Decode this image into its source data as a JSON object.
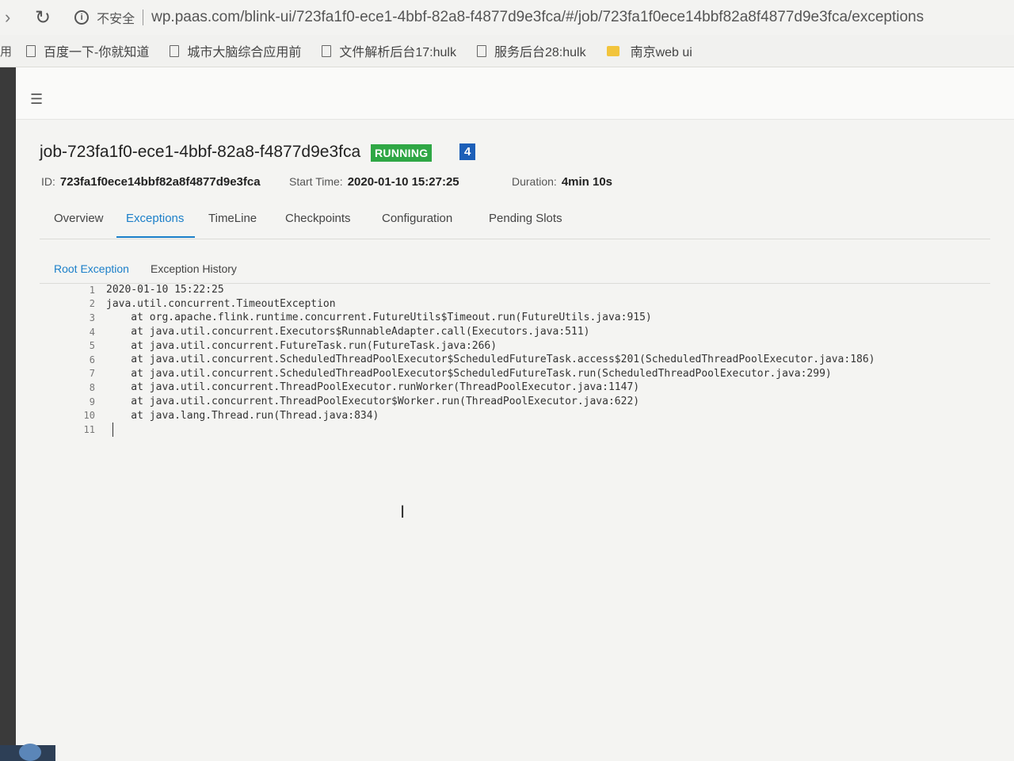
{
  "browser": {
    "security_label": "不安全",
    "url": "wp.paas.com/blink-ui/723fa1f0-ece1-4bbf-82a8-f4877d9e3fca/#/job/723fa1f0ece14bbf82a8f4877d9e3fca/exceptions",
    "apps_label": "用",
    "bookmarks": [
      {
        "label": "百度一下-你就知道",
        "icon": "file-icon"
      },
      {
        "label": "城市大脑综合应用前",
        "icon": "file-icon"
      },
      {
        "label": "文件解析后台17:hulk",
        "icon": "file-icon"
      },
      {
        "label": "服务后台28:hulk",
        "icon": "file-icon"
      },
      {
        "label": "南京web ui",
        "icon": "folder-icon"
      }
    ]
  },
  "job": {
    "title": "job-723fa1f0-ece1-4bbf-82a8-f4877d9e3fca",
    "status": "RUNNING",
    "status_color": "#2fa745",
    "count": "4",
    "count_color": "#1c5fb8",
    "id_label": "ID:",
    "id_value": "723fa1f0ece14bbf82a8f4877d9e3fca",
    "start_label": "Start Time:",
    "start_value": "2020-01-10 15:27:25",
    "duration_label": "Duration:",
    "duration_value": "4min 10s"
  },
  "tabs": [
    {
      "label": "Overview",
      "active": false
    },
    {
      "label": "Exceptions",
      "active": true
    },
    {
      "label": "TimeLine",
      "active": false
    },
    {
      "label": "Checkpoints",
      "active": false
    },
    {
      "label": "Configuration",
      "active": false
    },
    {
      "label": "Pending Slots",
      "active": false
    }
  ],
  "subtabs": [
    {
      "label": "Root Exception",
      "active": true
    },
    {
      "label": "Exception History",
      "active": false
    }
  ],
  "exception_lines": [
    {
      "n": "1",
      "text": "2020-01-10 15:22:25"
    },
    {
      "n": "2",
      "text": "java.util.concurrent.TimeoutException"
    },
    {
      "n": "3",
      "text": "    at org.apache.flink.runtime.concurrent.FutureUtils$Timeout.run(FutureUtils.java:915)"
    },
    {
      "n": "4",
      "text": "    at java.util.concurrent.Executors$RunnableAdapter.call(Executors.java:511)"
    },
    {
      "n": "5",
      "text": "    at java.util.concurrent.FutureTask.run(FutureTask.java:266)"
    },
    {
      "n": "6",
      "text": "    at java.util.concurrent.ScheduledThreadPoolExecutor$ScheduledFutureTask.access$201(ScheduledThreadPoolExecutor.java:186)"
    },
    {
      "n": "7",
      "text": "    at java.util.concurrent.ScheduledThreadPoolExecutor$ScheduledFutureTask.run(ScheduledThreadPoolExecutor.java:299)"
    },
    {
      "n": "8",
      "text": "    at java.util.concurrent.ThreadPoolExecutor.runWorker(ThreadPoolExecutor.java:1147)"
    },
    {
      "n": "9",
      "text": "    at java.util.concurrent.ThreadPoolExecutor$Worker.run(ThreadPoolExecutor.java:622)"
    },
    {
      "n": "10",
      "text": "    at java.lang.Thread.run(Thread.java:834)"
    },
    {
      "n": "11",
      "text": ""
    }
  ]
}
